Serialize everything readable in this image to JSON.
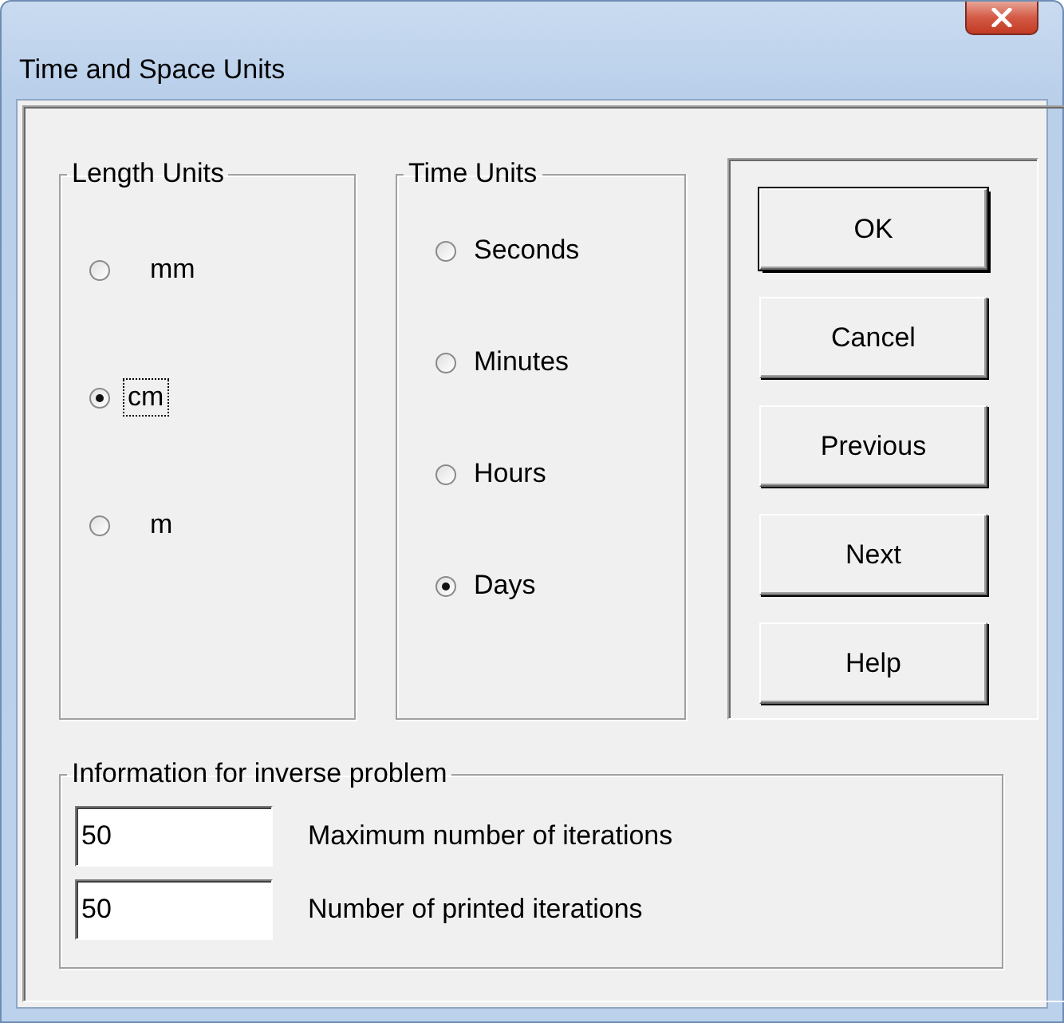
{
  "window": {
    "title": "Time and Space Units"
  },
  "length_units": {
    "label": "Length Units",
    "options": [
      {
        "label": "mm",
        "selected": false,
        "focused": false
      },
      {
        "label": "cm",
        "selected": true,
        "focused": true
      },
      {
        "label": "m",
        "selected": false,
        "focused": false
      }
    ]
  },
  "time_units": {
    "label": "Time Units",
    "options": [
      {
        "label": "Seconds",
        "selected": false,
        "focused": false
      },
      {
        "label": "Minutes",
        "selected": false,
        "focused": false
      },
      {
        "label": "Hours",
        "selected": false,
        "focused": false
      },
      {
        "label": "Days",
        "selected": true,
        "focused": false
      }
    ]
  },
  "buttons": [
    {
      "label": "OK",
      "default": true
    },
    {
      "label": "Cancel",
      "default": false
    },
    {
      "label": "Previous",
      "default": false
    },
    {
      "label": "Next",
      "default": false
    },
    {
      "label": "Help",
      "default": false
    }
  ],
  "inverse_problem": {
    "label": "Information for inverse problem",
    "fields": [
      {
        "value": "50",
        "label": "Maximum number of iterations"
      },
      {
        "value": "50",
        "label": "Number of printed iterations"
      }
    ]
  }
}
